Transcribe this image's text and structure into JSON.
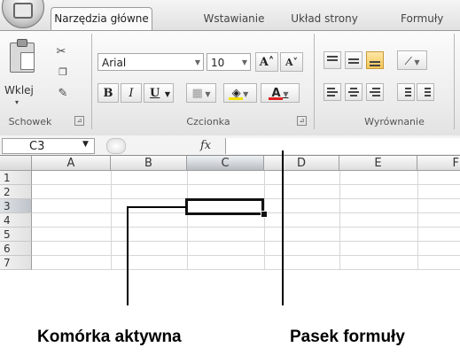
{
  "ribbon": {
    "tabs": [
      "Narzędzia główne",
      "Wstawianie",
      "Układ strony",
      "Formuły"
    ],
    "active_tab": "Narzędzia główne",
    "clipboard": {
      "paste_label": "Wklej",
      "group_label": "Schowek",
      "paste_arrow": "▾"
    },
    "font": {
      "family": "Arial",
      "size": "10",
      "bold": "B",
      "italic": "I",
      "underline": "U",
      "grow": "A˄",
      "shrink": "A˅",
      "font_color_glyph": "A",
      "group_label": "Czcionka"
    },
    "alignment": {
      "group_label": "Wyrównanie"
    },
    "launcher_glyph": "⊿"
  },
  "formula_bar": {
    "name_box": "C3",
    "fx": "fx",
    "formula": ""
  },
  "grid": {
    "columns": [
      "A",
      "B",
      "C",
      "D",
      "E",
      "F"
    ],
    "selected_column": "C",
    "rows": [
      "1",
      "2",
      "3",
      "4",
      "5",
      "6",
      "7"
    ],
    "selected_row": "3",
    "active_cell": "C3"
  },
  "captions": {
    "active_cell": "Komórka aktywna",
    "formula_bar": "Pasek formuły"
  },
  "colors": {
    "active_cell_border": "#111111",
    "font_color_underline": "#e02020",
    "highlight_underline": "#f4e000"
  }
}
